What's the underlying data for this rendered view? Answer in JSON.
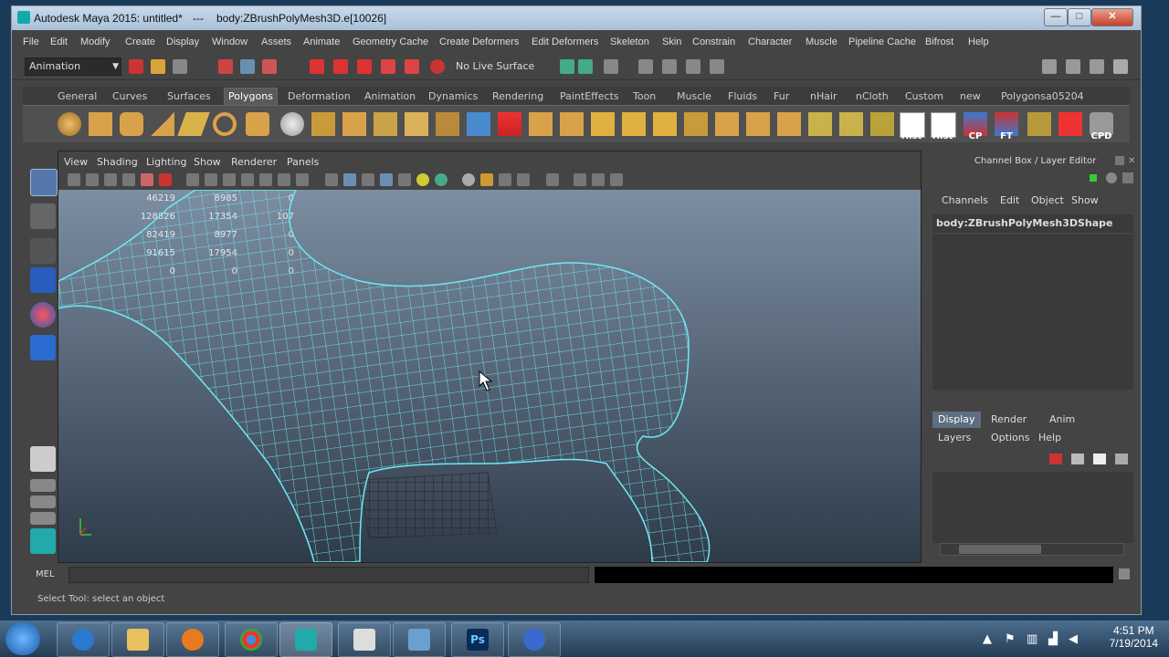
{
  "window": {
    "title": "Autodesk Maya 2015: untitled*",
    "sep": "---",
    "subtitle": "body:ZBrushPolyMesh3D.e[10026]",
    "min": "—",
    "max": "□",
    "close": "✕"
  },
  "menubar": [
    "File",
    "Edit",
    "Modify",
    "Create",
    "Display",
    "Window",
    "Assets",
    "Animate",
    "Geometry Cache",
    "Create Deformers",
    "Edit Deformers",
    "Skeleton",
    "Skin",
    "Constrain",
    "Character",
    "Muscle",
    "Pipeline Cache",
    "Bifrost",
    "Help"
  ],
  "status_line": {
    "mode": "Animation",
    "live_surface": "No Live Surface"
  },
  "shelf_tabs": [
    "General",
    "Curves",
    "Surfaces",
    "Polygons",
    "Deformation",
    "Animation",
    "Dynamics",
    "Rendering",
    "PaintEffects",
    "Toon",
    "Muscle",
    "Fluids",
    "Fur",
    "nHair",
    "nCloth",
    "Custom",
    "new",
    "Polygonsa05204"
  ],
  "shelf_active": "Polygons",
  "shelf_text_buttons": [
    "Hist",
    "Hist",
    "CP",
    "FT",
    "CPD"
  ],
  "viewport": {
    "menu": [
      "View",
      "Shading",
      "Lighting",
      "Show",
      "Renderer",
      "Panels"
    ],
    "hud": [
      [
        "46219",
        "8985",
        "0"
      ],
      [
        "128826",
        "17354",
        "107"
      ],
      [
        "82419",
        "8977",
        "0"
      ],
      [
        "91615",
        "17954",
        "0"
      ],
      [
        "0",
        "0",
        "0"
      ]
    ]
  },
  "channel_box": {
    "title": "Channel Box / Layer Editor",
    "tabs": [
      "Channels",
      "Edit",
      "Object",
      "Show"
    ],
    "object": "body:ZBrushPolyMesh3DShape"
  },
  "layer_editor": {
    "tabs": [
      "Display",
      "Render",
      "Anim"
    ],
    "active_tab": "Display",
    "menu": [
      "Layers",
      "Options",
      "Help"
    ]
  },
  "command_line": {
    "label": "MEL"
  },
  "help_line": "Select Tool: select an object",
  "taskbar": {
    "time": "4:51 PM",
    "date": "7/19/2014"
  }
}
